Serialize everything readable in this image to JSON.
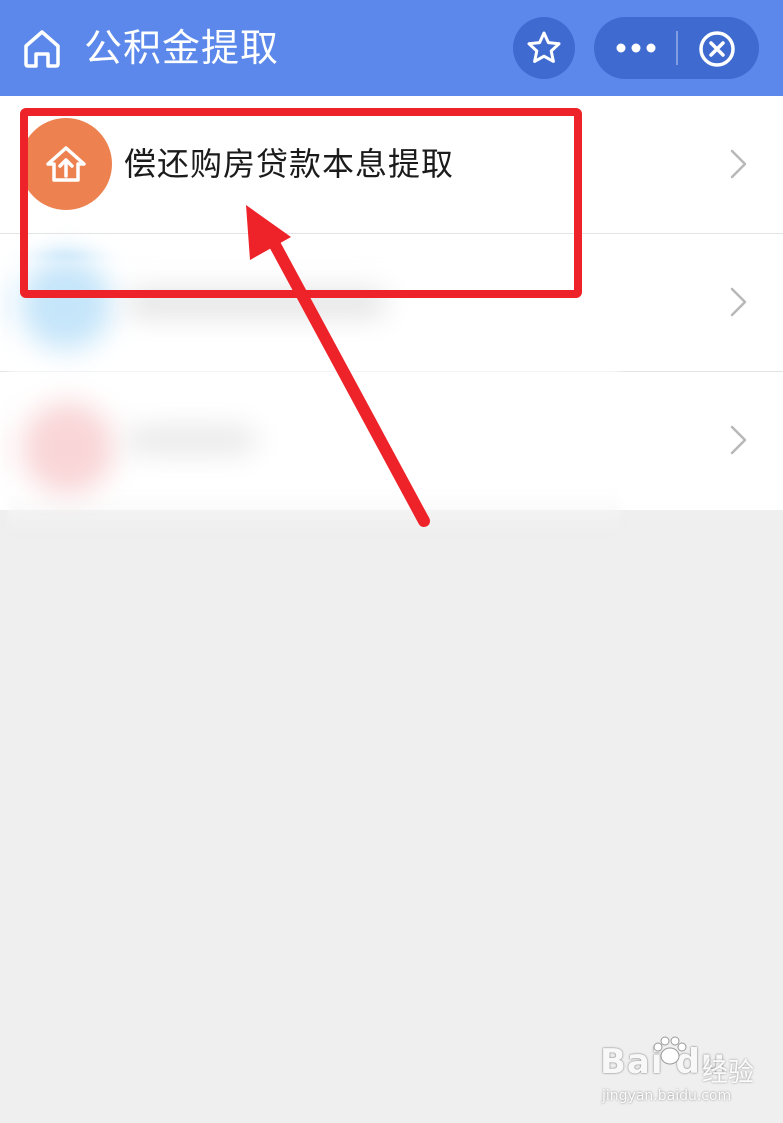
{
  "header": {
    "title": "公积金提取",
    "icons": {
      "home": "home-icon",
      "star": "star-icon",
      "more": "more-icon",
      "close": "close-circle-icon"
    },
    "colors": {
      "background": "#5b88ea",
      "button": "#3f6bd0",
      "text": "#ffffff"
    }
  },
  "list": {
    "items": [
      {
        "label": "偿还购房贷款本息提取",
        "icon": "house-upload-icon",
        "icon_color": "#ee8150"
      },
      {
        "label": "",
        "icon": "blurred-icon",
        "icon_color": "#7fc6f3"
      },
      {
        "label": "",
        "icon": "blurred-icon",
        "icon_color": "#f2a3a6"
      }
    ]
  },
  "annotation": {
    "highlight_color": "#ee2229"
  },
  "watermark": {
    "brand": "Bai",
    "brand_tail": "du",
    "cn": "经验",
    "url": "jingyan.baidu.com"
  }
}
